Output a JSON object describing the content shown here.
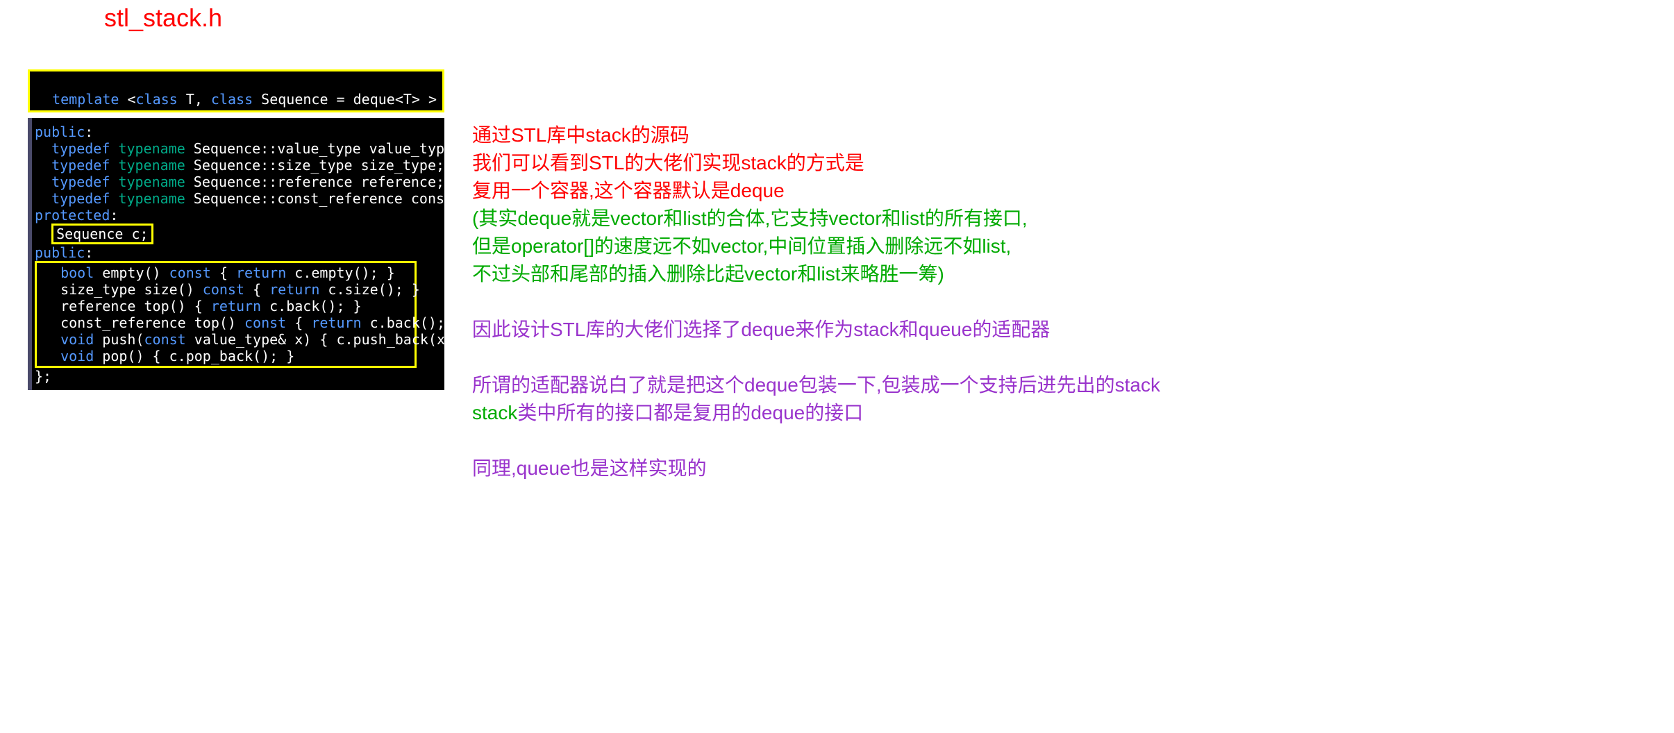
{
  "title": "stl_stack.h",
  "code1": {
    "template_kw": "template",
    "open_angle": " <",
    "class_kw_1": "class",
    "t_param": " T, ",
    "class_kw_2": "class",
    "seq": " Sequence = deque<T> >"
  },
  "code2": {
    "public1": "public",
    "colon": ":",
    "typedef": "typedef",
    "typename": "typename",
    "l1_rest": " Sequence::value_type value_type;",
    "l2_rest": " Sequence::size_type size_type;",
    "l3_rest": " Sequence::reference reference;",
    "l4_rest": " Sequence::const_reference const_reference;",
    "protected": "protected",
    "seq_c": "Sequence c;",
    "public2": "public",
    "bool": "bool",
    "empty_sig": " empty() ",
    "const": "const",
    "return": "return",
    "empty_body_open": " { ",
    "empty_body_ret": " c.empty(); }",
    "size_sig": "  size_type size() ",
    "size_body_open": " { ",
    "size_body_ret": " c.size(); }",
    "top1_sig": "  reference top() { ",
    "top1_ret": " c.back(); }",
    "top2_sig": "  const_reference top() ",
    "top2_open": " { ",
    "top2_ret": " c.back(); }",
    "void": "void",
    "push_sig": " push(",
    "push_param": " value_type& x) { c.push_back(x); }",
    "pop_sig": " pop() { c.pop_back(); }",
    "end_brace": "};"
  },
  "explain": {
    "r1": "通过STL库中stack的源码",
    "r2": "我们可以看到STL的大佬们实现stack的方式是",
    "r3": "复用一个容器,这个容器默认是deque",
    "g1": "(其实deque就是vector和list的合体,它支持vector和list的所有接口,",
    "g2": "但是operator[]的速度远不如vector,中间位置插入删除远不如list,",
    "g3": "不过头部和尾部的插入删除比起vector和list来略胜一筹)",
    "p1": "因此设计STL库的大佬们选择了deque来作为stack和queue的适配器",
    "p2a": "所谓的适配器说白了就是把这个deque包装一下,包装成一个支持后进先出的stack",
    "p2b_green": "stack",
    "p2b_purple": "类中所有的接口都是复用的deque的接口",
    "p3": "同理,queue也是这样实现的"
  }
}
